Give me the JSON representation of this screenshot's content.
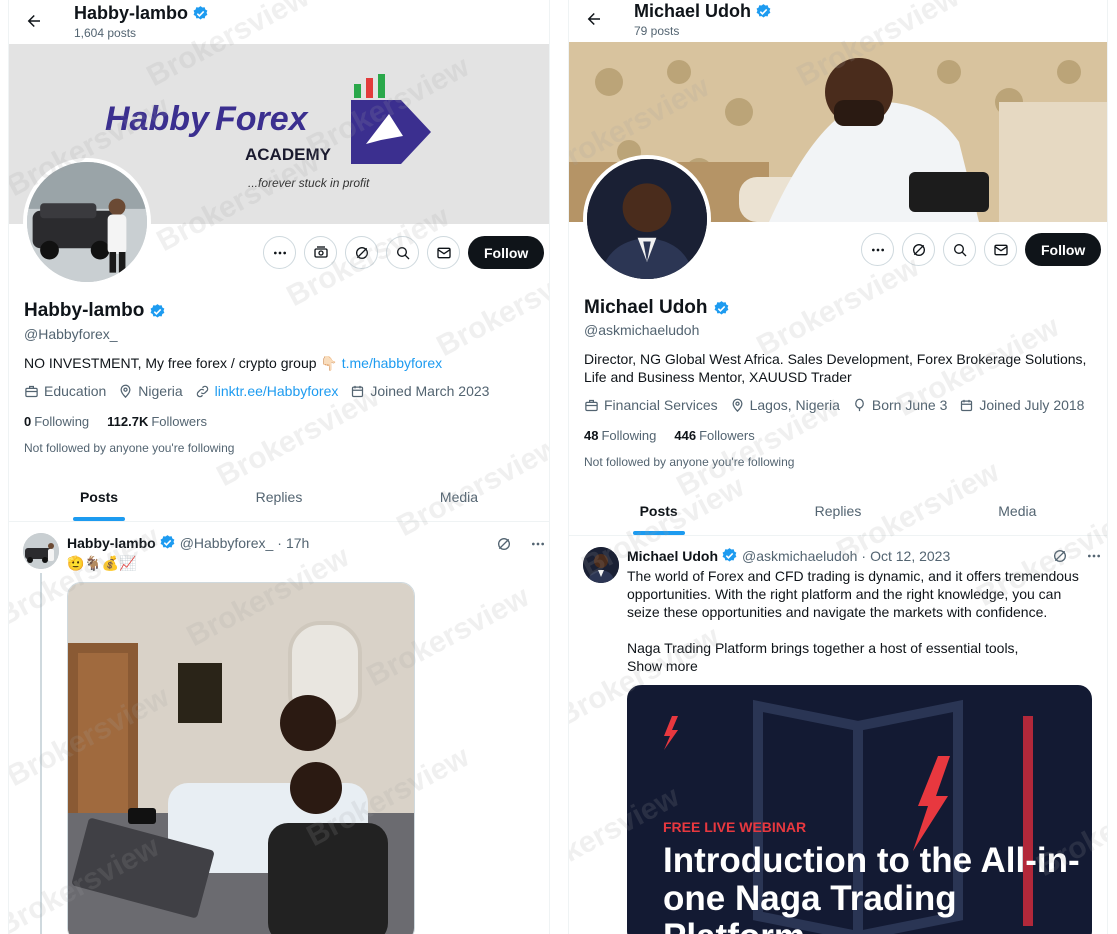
{
  "left": {
    "top_name": "Habby-lambo",
    "post_count": "1,604 posts",
    "banner": {
      "brand_part1": "Habby",
      "brand_part2": "Forex",
      "brand_sub": "ACADEMY",
      "tagline": "...forever stuck in profit"
    },
    "follow_label": "Follow",
    "name": "Habby-lambo",
    "handle": "@Habbyforex_",
    "bio_text": "NO INVESTMENT, My free forex / crypto group 👇🏻 ",
    "bio_link": "t.me/habbyforex",
    "meta": {
      "category": "Education",
      "location": "Nigeria",
      "website": "linktr.ee/Habbyforex",
      "joined": "Joined March 2023"
    },
    "following_count": "0",
    "following_label": "Following",
    "followers_count": "112.7K",
    "followers_label": "Followers",
    "not_followed": "Not followed by anyone you're following",
    "tabs": [
      "Posts",
      "Replies",
      "Media"
    ],
    "post": {
      "name": "Habby-lambo",
      "handle": "@Habbyforex_",
      "time": "17h",
      "text": "🫡🐐💰📈"
    }
  },
  "right": {
    "top_name": "Michael Udoh",
    "post_count": "79 posts",
    "follow_label": "Follow",
    "name": "Michael Udoh",
    "handle": "@askmichaeludoh",
    "bio": "Director, NG Global West Africa. Sales Development, Forex Brokerage Solutions, Life and Business Mentor, XAUUSD Trader",
    "meta": {
      "category": "Financial Services",
      "location": "Lagos, Nigeria",
      "birthday": "Born June 3",
      "joined": "Joined July 2018"
    },
    "following_count": "48",
    "following_label": "Following",
    "followers_count": "446",
    "followers_label": "Followers",
    "not_followed": "Not followed by anyone you're following",
    "tabs": [
      "Posts",
      "Replies",
      "Media"
    ],
    "post": {
      "name": "Michael Udoh",
      "handle": "@askmichaeludoh",
      "time": "Oct 12, 2023",
      "text1": "The world of Forex and CFD trading is dynamic, and it offers tremendous opportunities. With the right platform and the right knowledge, you can seize these opportunities and navigate the markets with confidence.",
      "text2": "Naga Trading Platform brings together a host of essential tools,",
      "show_more": "Show more",
      "card_tag": "FREE LIVE WEBINAR",
      "card_title": "Introduction to the All-in-one Naga Trading Platform"
    }
  },
  "watermark": "Brokersview",
  "colors": {
    "accent": "#1d9bf0",
    "text": "#0f1419",
    "muted": "#536471",
    "brand_purple": "#3b2f8f",
    "webinar_red": "#e8383f",
    "webinar_bg": "#131a33"
  }
}
